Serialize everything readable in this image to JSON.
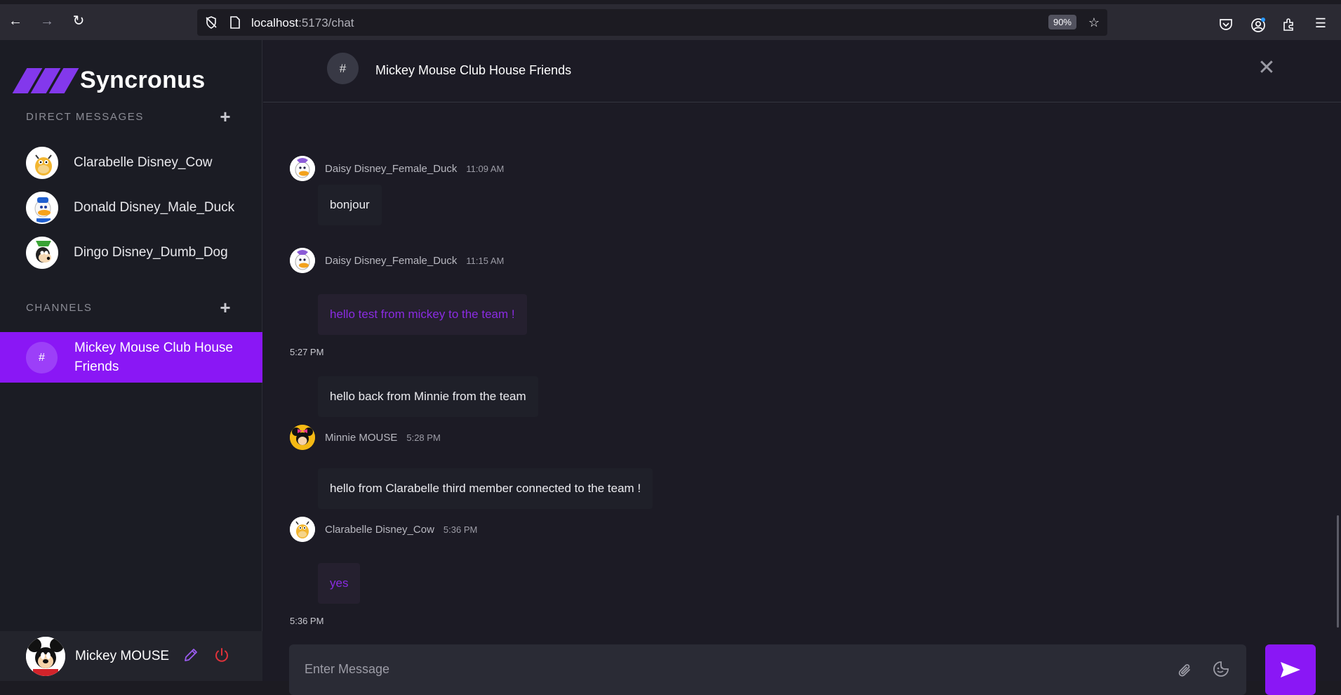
{
  "browser": {
    "url_host": "localhost",
    "url_path": ":5173/chat",
    "zoom": "90%"
  },
  "app": {
    "name": "Syncronus",
    "accent_color": "#8a17f5"
  },
  "sidebar": {
    "direct_messages_label": "DIRECT MESSAGES",
    "dms": [
      {
        "name": "Clarabelle Disney_Cow",
        "icon": "cow-avatar"
      },
      {
        "name": "Donald Disney_Male_Duck",
        "icon": "duck-avatar"
      },
      {
        "name": "Dingo Disney_Dumb_Dog",
        "icon": "dog-avatar"
      }
    ],
    "channels_label": "CHANNELS",
    "channels": [
      {
        "hash": "#",
        "name": "Mickey Mouse Club House Friends",
        "active": true
      }
    ]
  },
  "current_user": {
    "name": "Mickey MOUSE"
  },
  "chat": {
    "hash": "#",
    "title": "Mickey Mouse Club House Friends",
    "messages": [
      {
        "author": "Daisy Disney_Female_Duck",
        "time": "11:09 AM",
        "text": "bonjour"
      },
      {
        "author": "Daisy Disney_Female_Duck",
        "time": "11:15 AM",
        "text": "hello test from mickey to the team !",
        "own": true,
        "own_time": "5:27 PM"
      },
      {
        "text": "hello back from Minnie from the team"
      },
      {
        "author": "Minnie MOUSE",
        "time": "5:28 PM",
        "text": "hello from Clarabelle third member connected to the team !"
      },
      {
        "author": "Clarabelle Disney_Cow",
        "time": "5:36 PM",
        "text": "yes",
        "own": true,
        "own_time": "5:36 PM"
      }
    ],
    "input_placeholder": "Enter Message"
  }
}
